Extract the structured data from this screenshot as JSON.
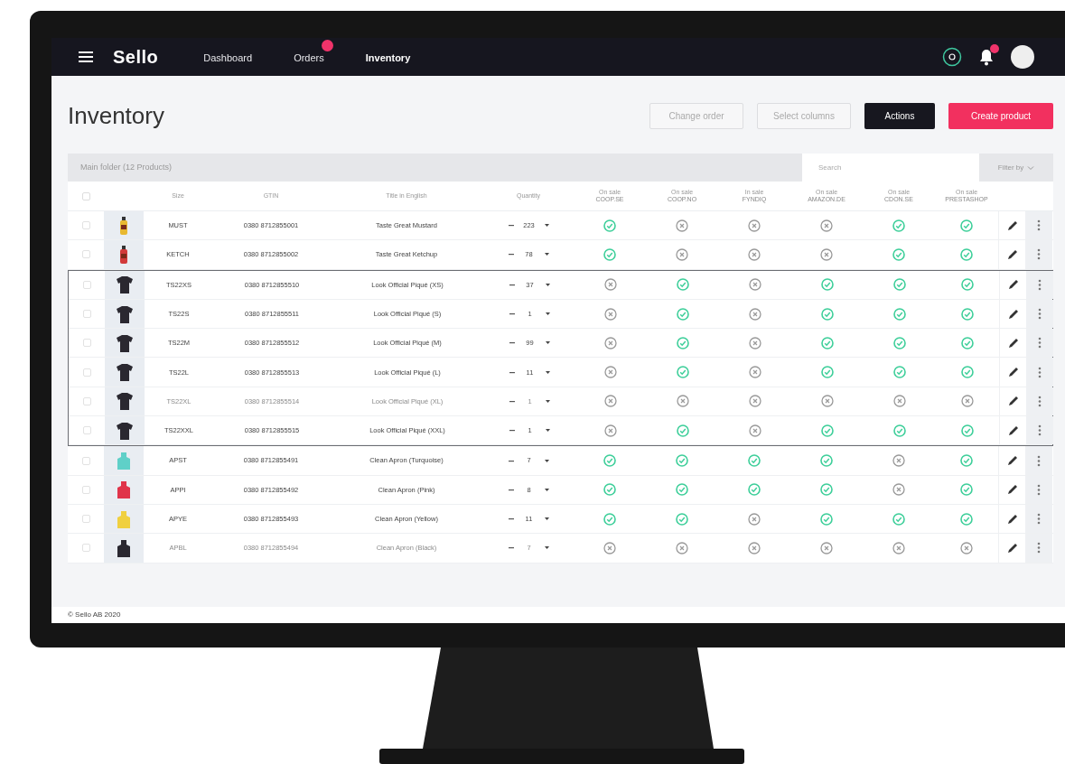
{
  "nav": {
    "logo": "Sello",
    "links": [
      {
        "label": "Dashboard",
        "selected": false,
        "badge": false
      },
      {
        "label": "Orders",
        "selected": false,
        "badge": true
      },
      {
        "label": "Inventory",
        "selected": true,
        "badge": false
      }
    ],
    "notifications_badge": true
  },
  "page": {
    "title": "Inventory",
    "buttons": [
      {
        "label": "Change order",
        "kind": "outline"
      },
      {
        "label": "Select columns",
        "kind": "outline"
      },
      {
        "label": "Actions",
        "kind": "dark"
      },
      {
        "label": "Create product",
        "kind": "primary"
      }
    ]
  },
  "toolbar": {
    "folder": "Main folder (12 Products)",
    "search": {
      "placeholder": "Search"
    },
    "filter": "Filter by"
  },
  "table": {
    "select_all": {
      "checked": false
    },
    "columns": [
      {
        "label": "Size"
      },
      {
        "label": "GTIN"
      },
      {
        "label": "Title in English"
      },
      {
        "label": "Quantity"
      }
    ],
    "channels": [
      {
        "status": "On sale",
        "name": "COOP.SE"
      },
      {
        "status": "On sale",
        "name": "COOP.NO"
      },
      {
        "status": "In sale",
        "name": "FYNDIQ"
      },
      {
        "status": "On sale",
        "name": "AMAZON.DE"
      },
      {
        "status": "On sale",
        "name": "CDON.SE"
      },
      {
        "status": "On sale",
        "name": "PRESTASHOP"
      }
    ],
    "rows": [
      {
        "kind": "product",
        "checked": false,
        "image": {
          "kind": "bottle",
          "color": "#e8b830"
        },
        "size": "MUST",
        "gtin": "0380 8712855001",
        "title": "Taste Great Mustard",
        "quantity": "223",
        "disabled": false,
        "on_sale": [
          true,
          false,
          false,
          false,
          true,
          true
        ]
      },
      {
        "kind": "product",
        "checked": false,
        "image": {
          "kind": "bottle",
          "color": "#d23a3a"
        },
        "size": "KETCH",
        "gtin": "0380 8712855002",
        "title": "Taste Great Ketchup",
        "quantity": "78",
        "disabled": false,
        "on_sale": [
          true,
          false,
          false,
          false,
          true,
          true
        ]
      },
      {
        "kind": "group",
        "children": [
          {
            "kind": "product",
            "checked": false,
            "image": {
              "kind": "tshirt",
              "color": "#2a2830"
            },
            "size": "TS22XS",
            "gtin": "0380 8712855510",
            "title": "Look Official Piqué (XS)",
            "quantity": "37",
            "disabled": false,
            "on_sale": [
              false,
              true,
              false,
              true,
              true,
              true
            ]
          },
          {
            "kind": "product",
            "checked": false,
            "image": {
              "kind": "tshirt",
              "color": "#2a2830"
            },
            "size": "TS22S",
            "gtin": "0380 8712855511",
            "title": "Look Official Piqué (S)",
            "quantity": "1",
            "disabled": false,
            "on_sale": [
              false,
              true,
              false,
              true,
              true,
              true
            ]
          },
          {
            "kind": "product",
            "checked": false,
            "image": {
              "kind": "tshirt",
              "color": "#2a2830"
            },
            "size": "TS22M",
            "gtin": "0380 8712855512",
            "title": "Look Official Piqué (M)",
            "quantity": "99",
            "disabled": false,
            "on_sale": [
              false,
              true,
              false,
              true,
              true,
              true
            ]
          },
          {
            "kind": "product",
            "checked": false,
            "image": {
              "kind": "tshirt",
              "color": "#2a2830"
            },
            "size": "TS22L",
            "gtin": "0380 8712855513",
            "title": "Look Official Piqué (L)",
            "quantity": "11",
            "disabled": false,
            "on_sale": [
              false,
              true,
              false,
              true,
              true,
              true
            ]
          },
          {
            "kind": "product",
            "checked": false,
            "image": {
              "kind": "tshirt",
              "color": "#2a2830"
            },
            "size": "TS22XL",
            "gtin": "0380 8712855514",
            "title": "Look Official Piqué (XL)",
            "quantity": "1",
            "disabled": true,
            "on_sale": [
              false,
              false,
              false,
              false,
              false,
              false
            ]
          },
          {
            "kind": "product",
            "checked": false,
            "image": {
              "kind": "tshirt",
              "color": "#2a2830"
            },
            "size": "TS22XXL",
            "gtin": "0380 8712855515",
            "title": "Look Official Piqué (XXL)",
            "quantity": "1",
            "disabled": false,
            "on_sale": [
              false,
              true,
              false,
              true,
              true,
              true
            ]
          }
        ]
      },
      {
        "kind": "product",
        "checked": false,
        "image": {
          "kind": "apron",
          "color": "#5fd0c8"
        },
        "size": "APST",
        "gtin": "0380 8712855491",
        "title": "Clean Apron (Turquoise)",
        "quantity": "7",
        "disabled": false,
        "on_sale": [
          true,
          true,
          true,
          true,
          false,
          true
        ]
      },
      {
        "kind": "product",
        "checked": false,
        "image": {
          "kind": "apron",
          "color": "#e0344a"
        },
        "size": "APPI",
        "gtin": "0380 8712855492",
        "title": "Clean Apron (Pink)",
        "quantity": "8",
        "disabled": false,
        "on_sale": [
          true,
          true,
          true,
          true,
          false,
          true
        ]
      },
      {
        "kind": "product",
        "checked": false,
        "image": {
          "kind": "apron",
          "color": "#f0d040"
        },
        "size": "APYE",
        "gtin": "0380 8712855493",
        "title": "Clean Apron (Yellow)",
        "quantity": "11",
        "disabled": false,
        "on_sale": [
          true,
          true,
          false,
          true,
          true,
          true
        ]
      },
      {
        "kind": "product",
        "checked": false,
        "image": {
          "kind": "apron",
          "color": "#2a2830"
        },
        "size": "APBL",
        "gtin": "0380 8712855494",
        "title": "Clean Apron (Black)",
        "quantity": "7",
        "disabled": true,
        "on_sale": [
          false,
          false,
          false,
          false,
          false,
          false
        ]
      }
    ]
  },
  "footer": "© Sello AB 2020"
}
